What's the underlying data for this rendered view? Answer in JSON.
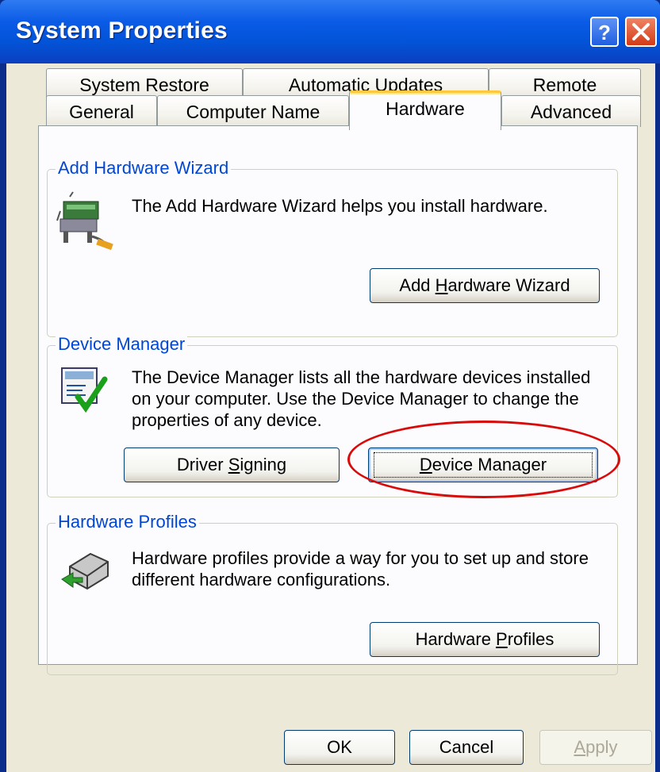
{
  "window": {
    "title": "System Properties"
  },
  "tabs": {
    "row1": [
      {
        "label": "System Restore"
      },
      {
        "label": "Automatic Updates"
      },
      {
        "label": "Remote"
      }
    ],
    "row2": [
      {
        "label": "General"
      },
      {
        "label": "Computer Name"
      },
      {
        "label": "Hardware",
        "active": true
      },
      {
        "label": "Advanced"
      }
    ]
  },
  "add_hardware": {
    "legend": "Add Hardware Wizard",
    "description": "The Add Hardware Wizard helps you install hardware.",
    "button": {
      "prefix": "Add ",
      "mnemonic": "H",
      "suffix": "ardware Wizard"
    }
  },
  "device_manager": {
    "legend": "Device Manager",
    "description_lines": [
      "The Device Manager lists all the hardware devices installed",
      "on your computer. Use the Device Manager to change the",
      "properties of any device."
    ],
    "driver_button": {
      "prefix": "Driver ",
      "mnemonic": "S",
      "suffix": "igning"
    },
    "dm_button": {
      "prefix": "",
      "mnemonic": "D",
      "suffix": "evice Manager"
    }
  },
  "hardware_profiles": {
    "legend": "Hardware Profiles",
    "description_lines": [
      "Hardware profiles provide a way for you to set up and store",
      "different hardware configurations."
    ],
    "button": {
      "prefix": "Hardware ",
      "mnemonic": "P",
      "suffix": "rofiles"
    }
  },
  "footer": {
    "ok": "OK",
    "cancel": "Cancel",
    "apply": {
      "prefix": "",
      "mnemonic": "A",
      "suffix": "pply"
    }
  },
  "colors": {
    "accent": "#0046d5",
    "annotation": "#d80a0a",
    "active_tab": "#ffc83c"
  },
  "icons": [
    "help-icon",
    "close-icon",
    "add-hardware-wizard-icon",
    "device-manager-icon",
    "hardware-profiles-icon"
  ]
}
